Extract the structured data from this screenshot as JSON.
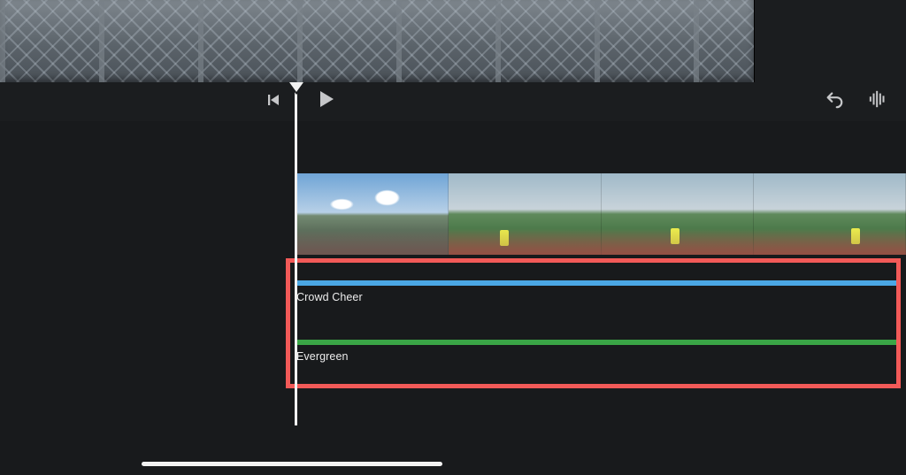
{
  "toolbar": {
    "previous_icon": "skip-back-icon",
    "play_icon": "play-icon",
    "undo_icon": "undo-icon",
    "audio_icon": "waveform-icon"
  },
  "timeline": {
    "clip_count": 4,
    "audio_tracks": [
      {
        "label": "Crowd Cheer",
        "color": "#4aa7e4"
      },
      {
        "label": "Evergreen",
        "color": "#3aa546"
      }
    ]
  }
}
